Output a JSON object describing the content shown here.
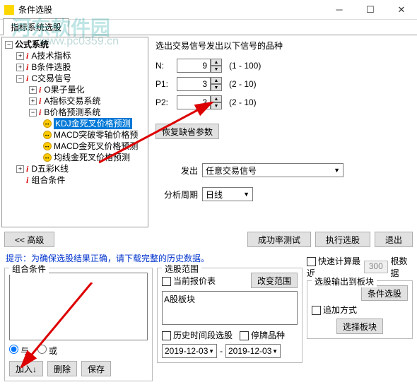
{
  "window": {
    "title": "条件选股"
  },
  "watermark": {
    "text": "河东软件园",
    "url": "www.pc0359.cn"
  },
  "tab": {
    "label": "指标系统选股"
  },
  "tree": {
    "root": "公式系统",
    "a": "A技术指标",
    "b": "B条件选股",
    "c": "C交易信号",
    "c_o": "O果子量化",
    "c_a": "A指标交易系统",
    "c_b": "B价格预测系统",
    "c_b_1": "KDJ金死叉价格预测",
    "c_b_2": "MACD突破零轴价格预",
    "c_b_3": "MACD金死叉价格预测",
    "c_b_4": "均线金死叉价格预测",
    "d": "D五彩K线",
    "e": "组合条件"
  },
  "params": {
    "title": "选出交易信号发出以下信号的品种",
    "n_label": "N:",
    "n_value": "9",
    "n_range": "(1 - 100)",
    "p1_label": "P1:",
    "p1_value": "3",
    "p1_range": "(2 - 10)",
    "p2_label": "P2:",
    "p2_value": "3",
    "p2_range": "(2 - 10)",
    "restore": "恢复缺省参数",
    "signal_label": "发出",
    "signal_value": "任意交易信号",
    "period_label": "分析周期",
    "period_value": "日线"
  },
  "buttons": {
    "advanced": "<< 高级",
    "test": "成功率测试",
    "run": "执行选股",
    "exit": "退出"
  },
  "hint": "提示：为确保选股结果正确，请下载完整的历史数据。",
  "combo": {
    "title": "组合条件",
    "and": "与",
    "or": "或",
    "add": "加入↓",
    "del": "删除",
    "save": "保存"
  },
  "scope": {
    "title": "选股范围",
    "current": "当前报价表",
    "change": "改变范围",
    "item": "A股板块",
    "history": "历史时间段选股",
    "suspend": "停牌品种",
    "date1": "2019-12-03",
    "date2": "2019-12-03"
  },
  "output": {
    "fast": "快速计算最近",
    "count": "300",
    "unit": "根数据",
    "title": "选股输出到板块",
    "cond": "条件选股",
    "append": "追加方式",
    "select": "选择板块"
  }
}
